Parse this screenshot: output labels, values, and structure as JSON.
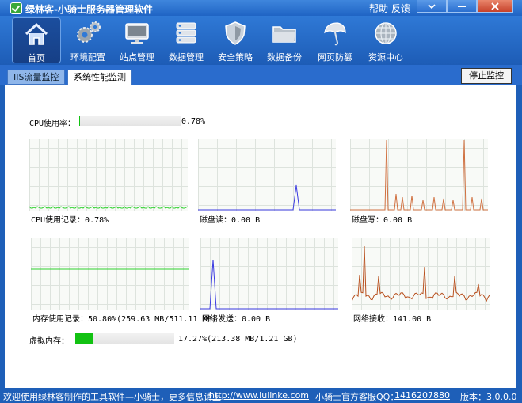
{
  "window": {
    "title": "绿林客-小骑士服务器管理软件",
    "help_link": "帮助",
    "feedback_link": "反馈"
  },
  "toolbar": {
    "items": [
      {
        "label": "首页",
        "icon": "home-icon"
      },
      {
        "label": "环境配置",
        "icon": "gears-icon"
      },
      {
        "label": "站点管理",
        "icon": "monitor-icon"
      },
      {
        "label": "数据管理",
        "icon": "database-icon"
      },
      {
        "label": "安全策略",
        "icon": "shield-icon"
      },
      {
        "label": "数据备份",
        "icon": "folder-icon"
      },
      {
        "label": "网页防篡",
        "icon": "umbrella-icon"
      },
      {
        "label": "资源中心",
        "icon": "globe-icon"
      }
    ]
  },
  "tabs": {
    "items": [
      "IIS流量监控",
      "系统性能监测"
    ],
    "active_index": 1,
    "stop_button": "停止监控"
  },
  "monitor": {
    "cpu_label": "CPU使用率：",
    "cpu_value": "0.78%",
    "cpu_fraction": 0.0078,
    "cpu_history_label": "CPU使用记录：0.78%",
    "disk_read_label": "磁盘读：0.00 B",
    "disk_write_label": "磁盘写：0.00 B",
    "memory_label": "内存使用记录：50.80%(259.63 MB/511.11 MB)",
    "net_send_label": "网络发送：0.00 B",
    "net_recv_label": "网络接收：141.00 B",
    "vmem_label": "虚拟内存：",
    "vmem_value": "17.27%(213.38 MB/1.21 GB)",
    "vmem_fraction": 0.1727
  },
  "colors": {
    "cpu_line": "#2fd22f",
    "disk_read_line": "#3a3ae0",
    "disk_write_line": "#d07040",
    "memory_line": "#2fd22f",
    "net_send_line": "#3a3ae0",
    "net_recv_line": "#b8501e",
    "bar_fill": "#12c212"
  },
  "statusbar": {
    "welcome": "欢迎使用绿林客制作的工具软件—小骑士，更多信息请上",
    "url": "http://www.lulinke.com",
    "support": "小骑士官方客服QQ：",
    "qq": "1416207880",
    "version": "版本：3.0.0.0"
  }
}
